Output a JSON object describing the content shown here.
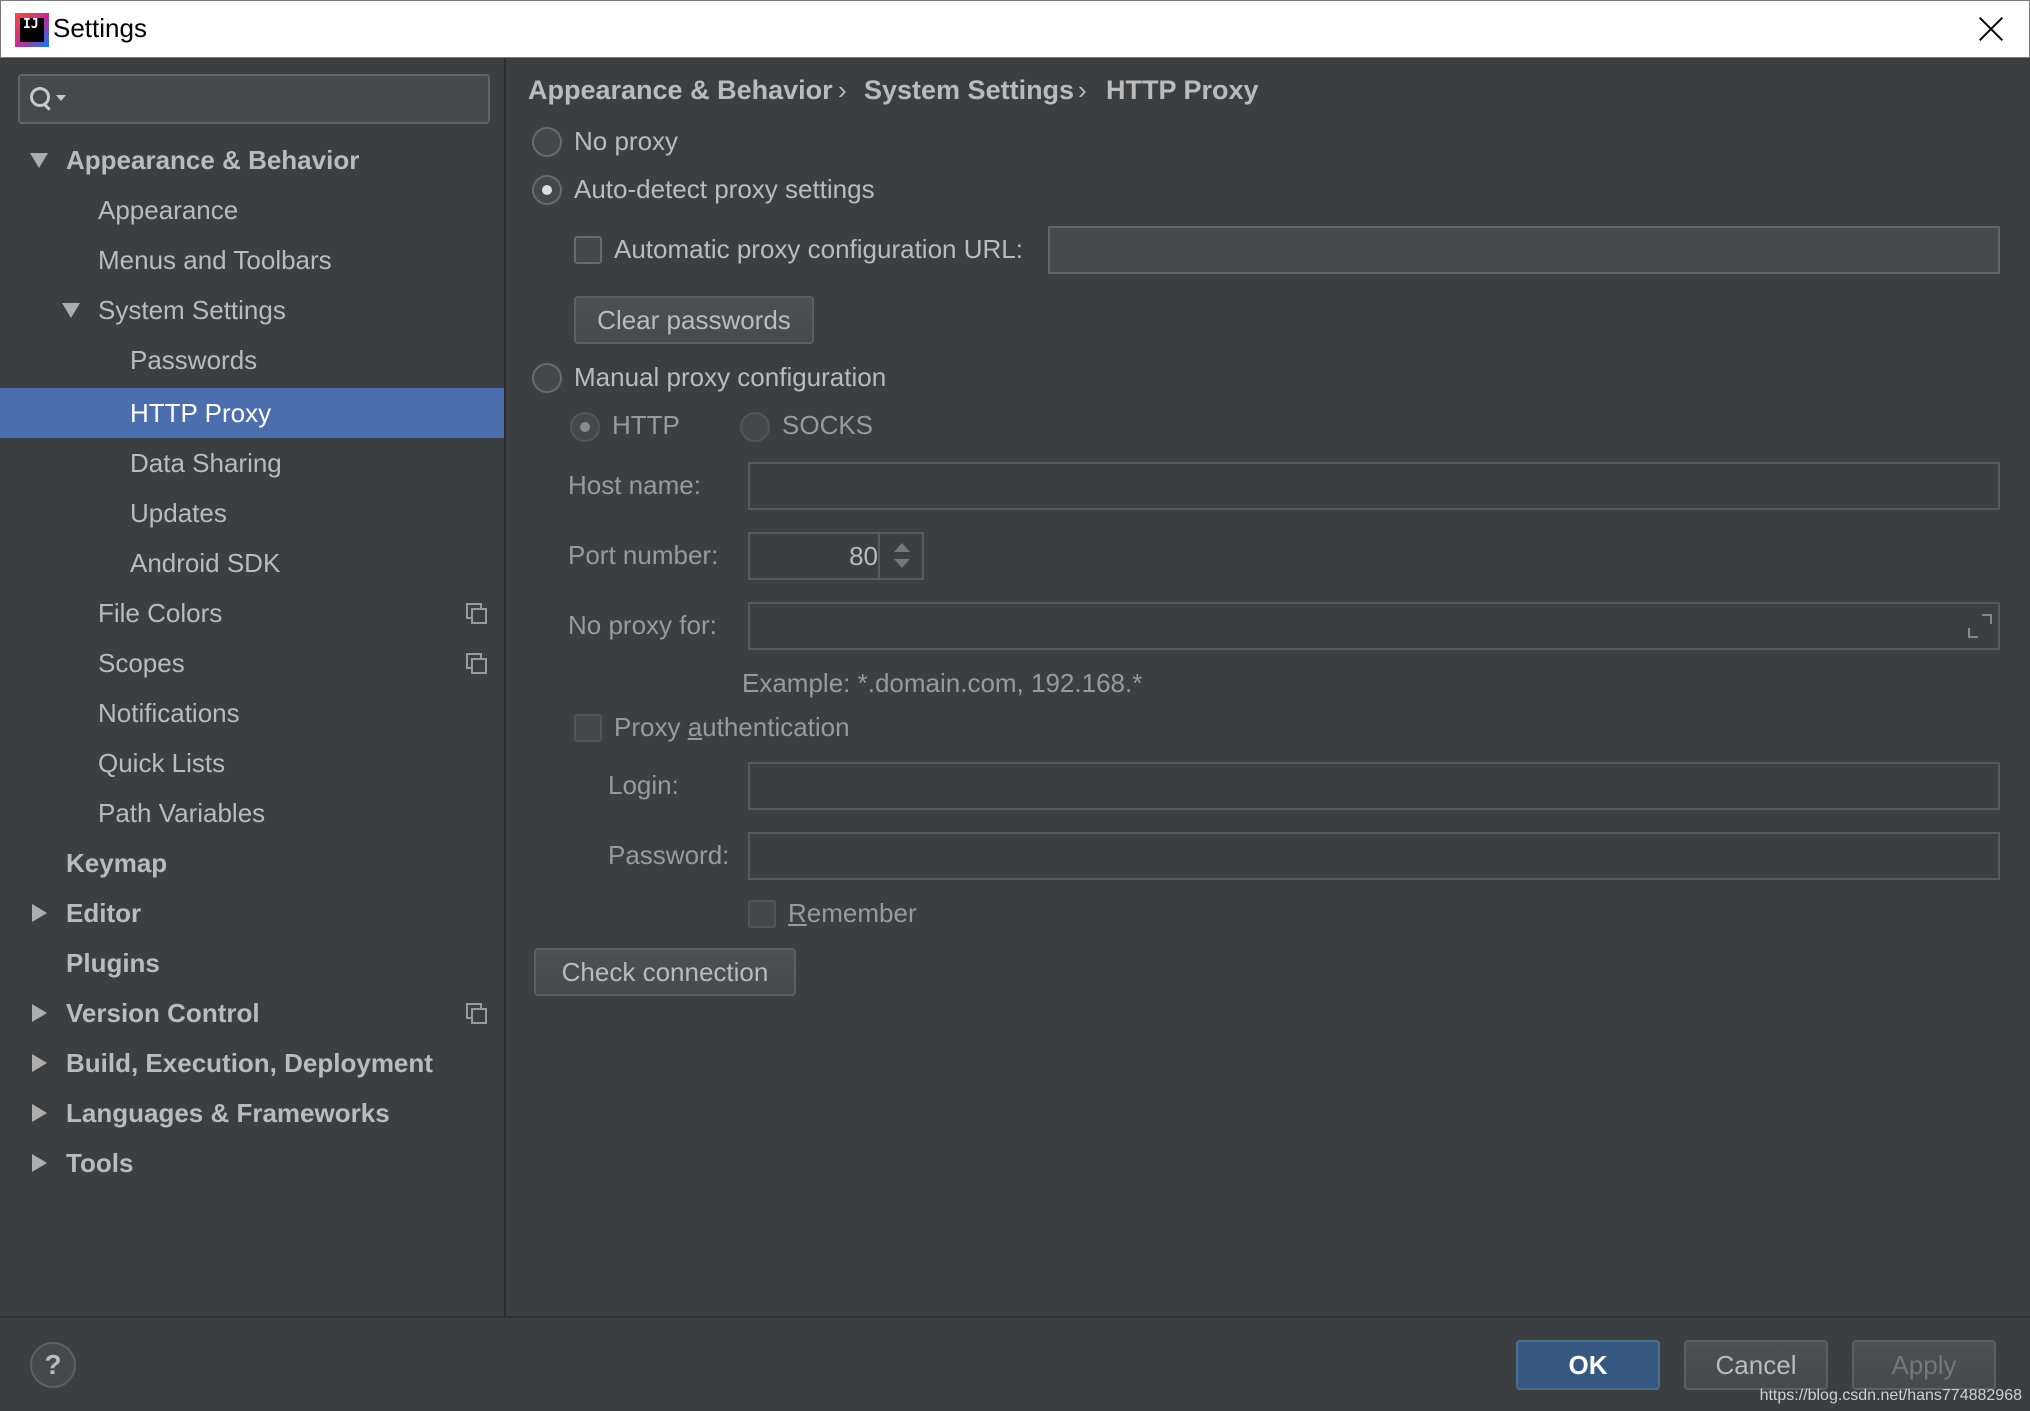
{
  "window": {
    "title": "Settings"
  },
  "search": {
    "placeholder": ""
  },
  "sidebar": {
    "items": [
      {
        "label": "Appearance & Behavior"
      },
      {
        "label": "Appearance"
      },
      {
        "label": "Menus and Toolbars"
      },
      {
        "label": "System Settings"
      },
      {
        "label": "Passwords"
      },
      {
        "label": "HTTP Proxy"
      },
      {
        "label": "Data Sharing"
      },
      {
        "label": "Updates"
      },
      {
        "label": "Android SDK"
      },
      {
        "label": "File Colors"
      },
      {
        "label": "Scopes"
      },
      {
        "label": "Notifications"
      },
      {
        "label": "Quick Lists"
      },
      {
        "label": "Path Variables"
      },
      {
        "label": "Keymap"
      },
      {
        "label": "Editor"
      },
      {
        "label": "Plugins"
      },
      {
        "label": "Version Control"
      },
      {
        "label": "Build, Execution, Deployment"
      },
      {
        "label": "Languages & Frameworks"
      },
      {
        "label": "Tools"
      }
    ]
  },
  "breadcrumb": [
    "Appearance & Behavior",
    "System Settings",
    "HTTP Proxy"
  ],
  "breadcrumb_sep": "›",
  "proxy": {
    "no_proxy": "No proxy",
    "auto_detect": "Auto-detect proxy settings",
    "auto_config_url": "Automatic proxy configuration URL:",
    "clear_passwords": "Clear passwords",
    "manual": "Manual proxy configuration",
    "http": "HTTP",
    "socks": "SOCKS",
    "host_label": "Host name:",
    "port_label": "Port number:",
    "port_value": "80",
    "no_proxy_for_label": "No proxy for:",
    "example": "Example: *.domain.com, 192.168.*",
    "proxy_auth_pre": "Proxy ",
    "proxy_auth_u": "a",
    "proxy_auth_post": "uthentication",
    "login_label": "Login:",
    "password_label": "Password:",
    "remember_u": "R",
    "remember_post": "emember",
    "check_connection": "Check connection"
  },
  "footer": {
    "help": "?",
    "ok": "OK",
    "cancel": "Cancel",
    "apply": "Apply",
    "watermark": "https://blog.csdn.net/hans774882968"
  }
}
